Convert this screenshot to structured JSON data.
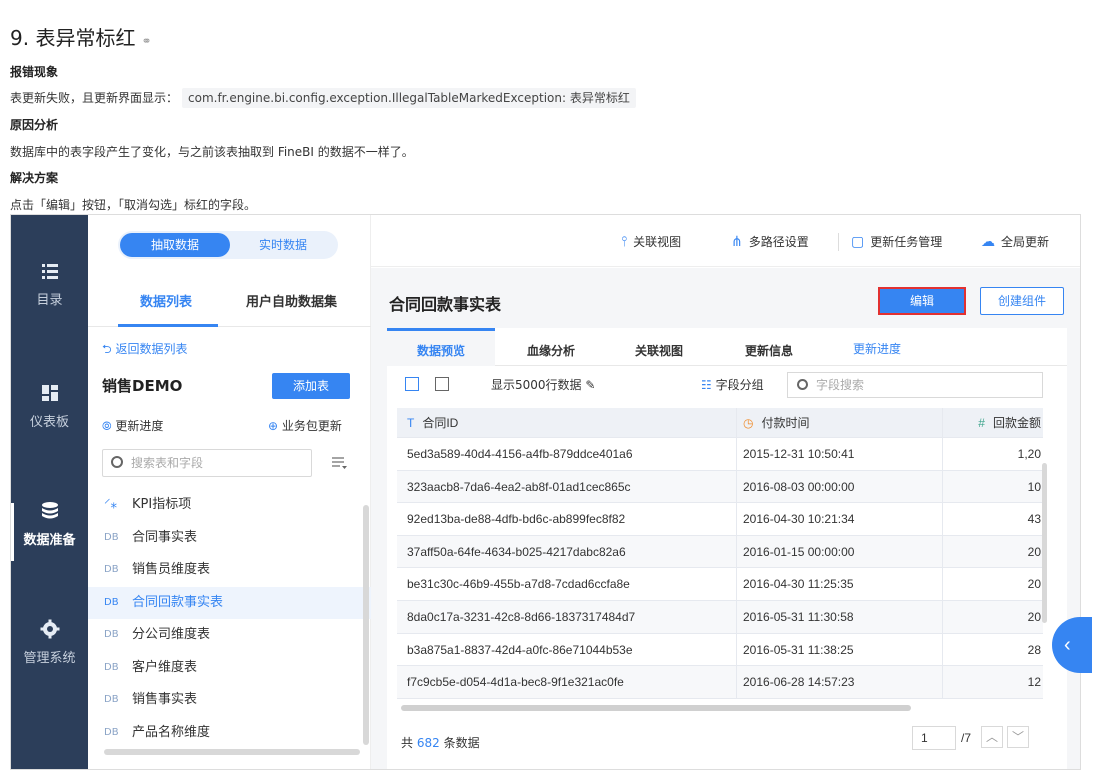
{
  "doc": {
    "heading": "9. 表异常标红",
    "heading_link_icon": "link-icon",
    "sections": [
      {
        "title": "报错现象",
        "text": "表更新失败，且更新界面显示：",
        "code": "com.fr.engine.bi.config.exception.IllegalTableMarkedException: 表异常标红"
      },
      {
        "title": "原因分析",
        "text": "数据库中的表字段产生了变化，与之前该表抽取到 FineBI 的数据不一样了。"
      },
      {
        "title": "解决方案",
        "text": "点击「编辑」按钮，「取消勾选」标红的字段。"
      }
    ]
  },
  "nav": {
    "items": [
      {
        "label": "目录",
        "icon": "list-icon"
      },
      {
        "label": "仪表板",
        "icon": "dashboard-icon"
      },
      {
        "label": "数据准备",
        "icon": "database-icon",
        "active": true
      },
      {
        "label": "管理系统",
        "icon": "gear-icon"
      }
    ]
  },
  "left": {
    "segment": {
      "on": "抽取数据",
      "off": "实时数据"
    },
    "tabs": [
      "数据列表",
      "用户自助数据集"
    ],
    "back": "返回数据列表",
    "package_name": "销售DEMO",
    "add_table": "添加表",
    "update_progress": "更新进度",
    "package_update": "业务包更新",
    "search_placeholder": "搜索表和字段",
    "tables": [
      {
        "label": "KPI指标项",
        "icon": "kpi-icon"
      },
      {
        "label": "合同事实表",
        "icon": "DB"
      },
      {
        "label": "销售员维度表",
        "icon": "DB"
      },
      {
        "label": "合同回款事实表",
        "icon": "DB",
        "selected": true
      },
      {
        "label": "分公司维度表",
        "icon": "DB"
      },
      {
        "label": "客户维度表",
        "icon": "DB"
      },
      {
        "label": "销售事实表",
        "icon": "DB"
      },
      {
        "label": "产品名称维度",
        "icon": "DB"
      }
    ]
  },
  "topbar": {
    "items": [
      "关联视图",
      "多路径设置",
      "更新任务管理",
      "全局更新"
    ]
  },
  "main": {
    "title": "合同回款事实表",
    "edit": "编辑",
    "create": "创建组件",
    "tabs": [
      "数据预览",
      "血缘分析",
      "关联视图",
      "更新信息",
      "更新进度"
    ],
    "show_rows": "显示5000行数据",
    "field_group": "字段分组",
    "field_search_placeholder": "字段搜索",
    "columns": [
      "合同ID",
      "付款时间",
      "回款金额"
    ],
    "rows": [
      [
        "5ed3a589-40d4-4156-a4fb-879ddce401a6",
        "2015-12-31 10:50:41",
        "1,20"
      ],
      [
        "323aacb8-7da6-4ea2-ab8f-01ad1cec865c",
        "2016-08-03 00:00:00",
        "10"
      ],
      [
        "92ed13ba-de88-4dfb-bd6c-ab899fec8f82",
        "2016-04-30 10:21:34",
        "43"
      ],
      [
        "37aff50a-64fe-4634-b025-4217dabc82a6",
        "2016-01-15 00:00:00",
        "20"
      ],
      [
        "be31c30c-46b9-455b-a7d8-7cdad6ccfa8e",
        "2016-04-30 11:25:35",
        "20"
      ],
      [
        "8da0c17a-3231-42c8-8d66-1837317484d7",
        "2016-05-31 11:30:58",
        "20"
      ],
      [
        "b3a875a1-8837-42d4-a0fc-86e71044b53e",
        "2016-05-31 11:38:25",
        "28"
      ],
      [
        "f7c9cb5e-d054-4d1a-bec8-9f1e321ac0fe",
        "2016-06-28 14:57:23",
        "12"
      ]
    ],
    "total_prefix": "共",
    "total_count": "682",
    "total_suffix": "条数据",
    "page": "1",
    "page_total": "/7"
  }
}
